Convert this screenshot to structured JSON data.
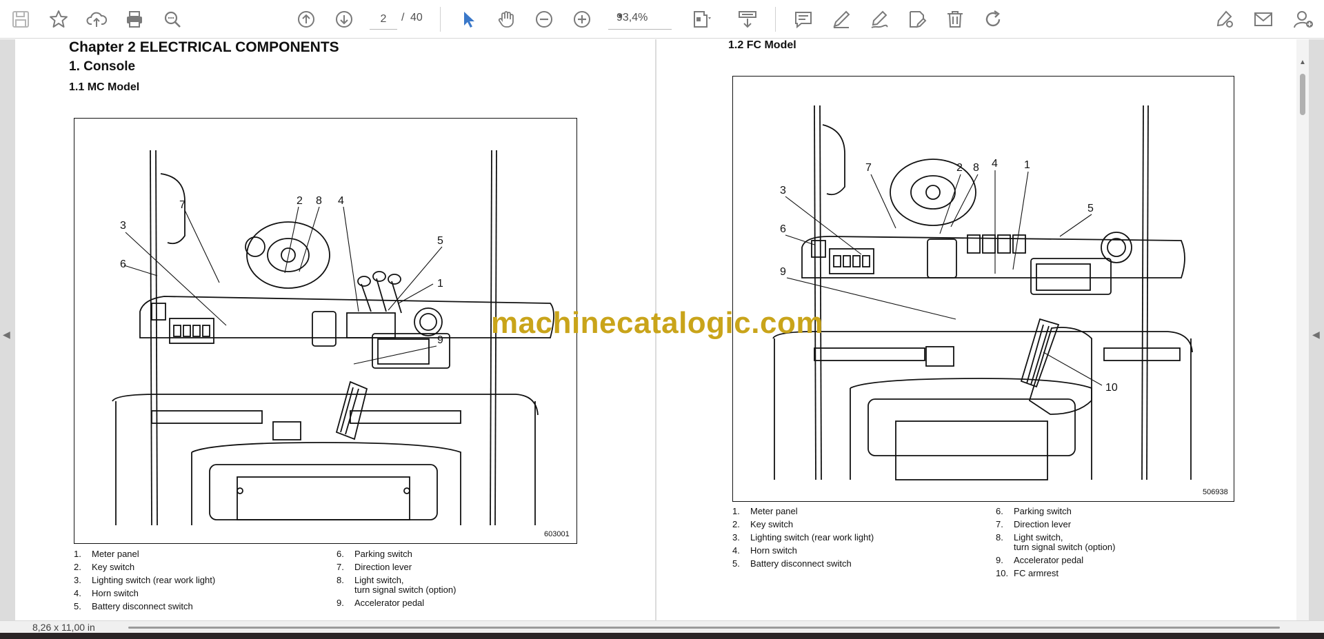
{
  "toolbar": {
    "current_page": "2",
    "page_separator": "/",
    "total_pages": "40",
    "zoom": "93,4%"
  },
  "left_page": {
    "chapter": "Chapter 2    ELECTRICAL COMPONENTS",
    "section": "1.    Console",
    "subsection": "1.1      MC Model",
    "figure_id": "603001",
    "callouts": [
      "7",
      "2",
      "8",
      "4",
      "3",
      "5",
      "6",
      "1",
      "9"
    ],
    "legend_left": [
      {
        "num": "1.",
        "text": "Meter panel"
      },
      {
        "num": "2.",
        "text": "Key switch"
      },
      {
        "num": "3.",
        "text": "Lighting switch (rear work light)"
      },
      {
        "num": "4.",
        "text": "Horn switch"
      },
      {
        "num": "5.",
        "text": "Battery disconnect switch"
      }
    ],
    "legend_right": [
      {
        "num": "6.",
        "text": "Parking switch"
      },
      {
        "num": "7.",
        "text": "Direction lever"
      },
      {
        "num": "8.",
        "text": "Light switch,"
      },
      {
        "num": "",
        "text": "turn signal switch (option)"
      },
      {
        "num": "9.",
        "text": "Accelerator pedal"
      }
    ]
  },
  "right_page": {
    "subsection": "1.2      FC Model",
    "figure_id": "506938",
    "callouts": [
      "7",
      "2",
      "8",
      "4",
      "1",
      "3",
      "5",
      "6",
      "9",
      "10"
    ],
    "legend_left": [
      {
        "num": "1.",
        "text": "Meter panel"
      },
      {
        "num": "2.",
        "text": "Key switch"
      },
      {
        "num": "3.",
        "text": "Lighting switch (rear work light)"
      },
      {
        "num": "4.",
        "text": "Horn switch"
      },
      {
        "num": "5.",
        "text": "Battery disconnect switch"
      }
    ],
    "legend_right": [
      {
        "num": "6.",
        "text": "Parking switch"
      },
      {
        "num": "7.",
        "text": "Direction lever"
      },
      {
        "num": "8.",
        "text": "Light switch,"
      },
      {
        "num": "",
        "text": "turn signal switch (option)"
      },
      {
        "num": "9.",
        "text": "Accelerator pedal"
      },
      {
        "num": "10.",
        "text": "FC armrest"
      }
    ]
  },
  "watermark": "machinecatalogic.com",
  "status": {
    "page_size": "8,26 x 11,00 in"
  },
  "colors": {
    "accent_select_tool": "#3a78c9",
    "watermark": "#c9a41a",
    "icon_gray": "#7a7a7a"
  },
  "icons": [
    "save-icon",
    "bookmark-star-icon",
    "upload-cloud-icon",
    "print-icon",
    "zoom-search-icon",
    "page-up-icon",
    "page-down-icon",
    "select-pointer-icon",
    "pan-hand-icon",
    "zoom-out-icon",
    "zoom-in-icon",
    "page-fit-icon",
    "scroll-mode-icon",
    "comment-icon",
    "highlight-pen-icon",
    "draw-pen-icon",
    "edit-text-icon",
    "delete-trash-icon",
    "rotate-icon",
    "sign-icon",
    "email-icon",
    "add-user-icon"
  ]
}
